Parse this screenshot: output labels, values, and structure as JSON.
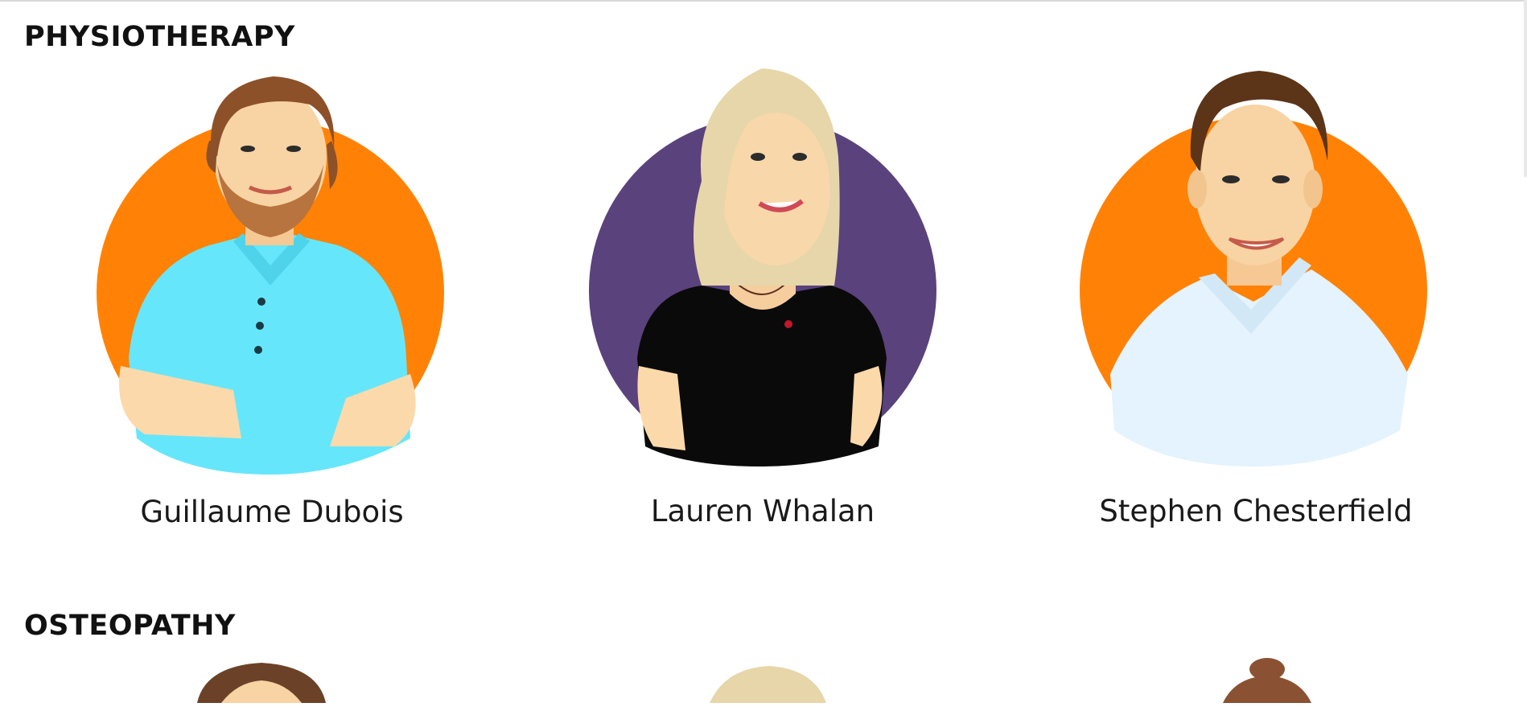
{
  "sections": [
    {
      "title": "PHYSIOTHERAPY",
      "people": [
        {
          "name": "Guillaume Dubois",
          "bg_color": "#ff8206",
          "shirt_color": "#66e6fb"
        },
        {
          "name": "Lauren Whalan",
          "bg_color": "#5a427c",
          "shirt_color": "#0a0a0a"
        },
        {
          "name": "Stephen Chesterfield",
          "bg_color": "#ff8206",
          "shirt_color": "#e4f3fd"
        }
      ]
    },
    {
      "title": "OSTEOPATHY",
      "people": [
        {
          "name": "",
          "hair_color": "#6b4228"
        },
        {
          "name": "",
          "hair_color": "#e6d6aa"
        },
        {
          "name": "",
          "hair_color": "#8a5232"
        }
      ]
    }
  ]
}
